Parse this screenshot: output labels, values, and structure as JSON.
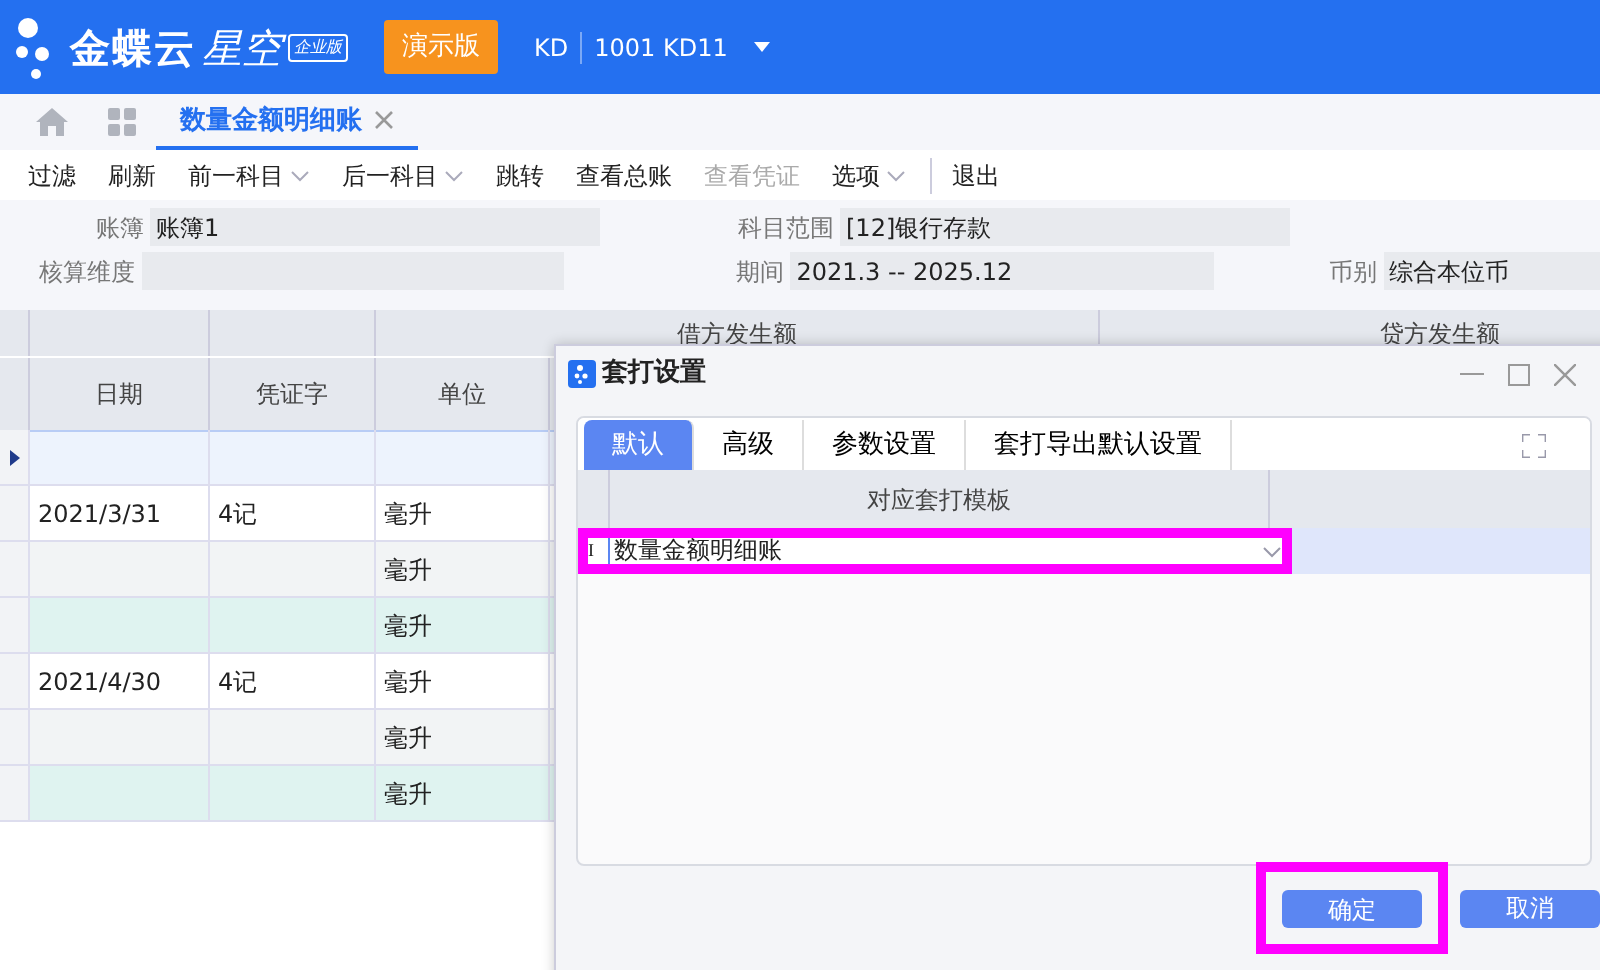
{
  "header": {
    "logo": "金蝶云",
    "product": "星空",
    "edition": "企业版",
    "demo_badge": "演示版",
    "org": "KD",
    "account": "1001  KD11"
  },
  "tabs": [
    {
      "label": "数量金额明细账",
      "selected": true
    }
  ],
  "toolbar": [
    {
      "label": "过滤",
      "dropdown": false,
      "disabled": false,
      "divider_before": false
    },
    {
      "label": "刷新",
      "dropdown": false,
      "disabled": false,
      "divider_before": false
    },
    {
      "label": "前一科目",
      "dropdown": true,
      "disabled": false,
      "divider_before": false
    },
    {
      "label": "后一科目",
      "dropdown": true,
      "disabled": false,
      "divider_before": false
    },
    {
      "label": "跳转",
      "dropdown": false,
      "disabled": false,
      "divider_before": false
    },
    {
      "label": "查看总账",
      "dropdown": false,
      "disabled": false,
      "divider_before": false
    },
    {
      "label": "查看凭证",
      "dropdown": false,
      "disabled": true,
      "divider_before": false
    },
    {
      "label": "选项",
      "dropdown": true,
      "disabled": false,
      "divider_before": false
    },
    {
      "label": "退出",
      "dropdown": false,
      "disabled": false,
      "divider_before": true
    }
  ],
  "filters": [
    [
      {
        "label": "账簿",
        "value": "账簿1"
      },
      {
        "label": "科目范围",
        "value": "[12]银行存款"
      }
    ],
    [
      {
        "label": "核算维度"
      },
      {
        "label": "期间",
        "value": "2021.3 -- 2025.12"
      },
      {
        "label": "币别",
        "value": "综合本位币"
      }
    ]
  ],
  "grid": {
    "group_headers": [
      "借方发生额",
      "贷方发生额"
    ],
    "columns": [
      "日期",
      "凭证字",
      "单位"
    ],
    "rows": [
      {
        "selected": true,
        "color": "#edf3fd"
      },
      {
        "date": "2021/3/31",
        "voucher": "4记",
        "unit": "毫升",
        "selected": false,
        "color": "#ffffff"
      },
      {
        "unit": "毫升",
        "selected": false,
        "color": "#f2f4f5"
      },
      {
        "unit": "毫升",
        "selected": false,
        "color": "#dff3f0"
      },
      {
        "date": "2021/4/30",
        "voucher": "4记",
        "unit": "毫升",
        "selected": false,
        "color": "#ffffff"
      },
      {
        "unit": "毫升",
        "selected": false,
        "color": "#f2f4f5"
      },
      {
        "unit": "毫升",
        "selected": false,
        "color": "#dff3f0"
      }
    ]
  },
  "dialog": {
    "title": "套打设置",
    "tabs": [
      {
        "label": "默认",
        "selected": true
      },
      {
        "label": "高级",
        "selected": false
      },
      {
        "label": "参数设置",
        "selected": false
      },
      {
        "label": "套打导出默认设置",
        "selected": false
      }
    ],
    "column": "对应套打模板",
    "rows": [
      {
        "marker": "I",
        "value": "数量金额明细账",
        "highlighted": true
      }
    ],
    "buttons": [
      {
        "label": "确定",
        "highlighted": true
      },
      {
        "label": "取消",
        "highlighted": false
      }
    ]
  }
}
